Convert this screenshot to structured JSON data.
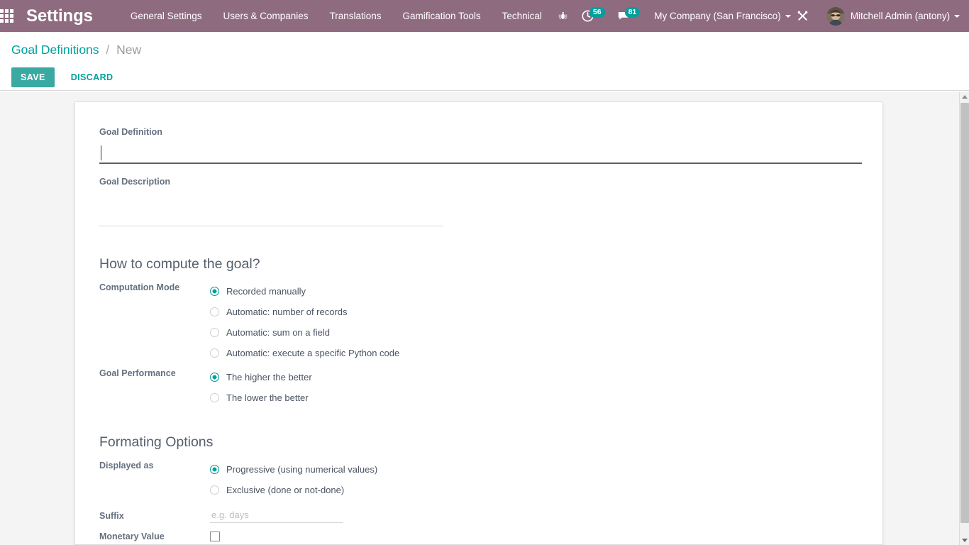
{
  "navbar": {
    "apps_icon": "apps-grid-icon",
    "brand": "Settings",
    "menu": [
      {
        "label": "General Settings"
      },
      {
        "label": "Users & Companies"
      },
      {
        "label": "Translations"
      },
      {
        "label": "Gamification Tools"
      },
      {
        "label": "Technical"
      }
    ],
    "bug_icon": "bug-icon",
    "activities": {
      "icon": "clock-icon",
      "count": "56"
    },
    "messages": {
      "icon": "chat-bubble-icon",
      "count": "81"
    },
    "company": {
      "label": "My Company (San Francisco)",
      "caret": "chevron-down-icon"
    },
    "tools_icon": "tools-icon",
    "user": {
      "name": "Mitchell Admin (antony)",
      "caret": "chevron-down-icon",
      "avatar": "user-avatar"
    },
    "background_color": "#8f6b80"
  },
  "control_panel": {
    "breadcrumb": {
      "root": "Goal Definitions",
      "separator": "/",
      "current": "New"
    },
    "save_label": "SAVE",
    "discard_label": "DISCARD",
    "accent_color": "#00a09d",
    "save_button_color": "#3aa9a2"
  },
  "form": {
    "goal_definition": {
      "label": "Goal Definition",
      "value": "",
      "placeholder": ""
    },
    "goal_description": {
      "label": "Goal Description",
      "value": "",
      "placeholder": ""
    },
    "compute_section": {
      "title": "How to compute the goal?",
      "computation_mode": {
        "label": "Computation Mode",
        "options": [
          {
            "label": "Recorded manually",
            "selected": true
          },
          {
            "label": "Automatic: number of records",
            "selected": false
          },
          {
            "label": "Automatic: sum on a field",
            "selected": false
          },
          {
            "label": "Automatic: execute a specific Python code",
            "selected": false
          }
        ]
      },
      "goal_performance": {
        "label": "Goal Performance",
        "options": [
          {
            "label": "The higher the better",
            "selected": true
          },
          {
            "label": "The lower the better",
            "selected": false
          }
        ]
      }
    },
    "formating_section": {
      "title": "Formating Options",
      "displayed_as": {
        "label": "Displayed as",
        "options": [
          {
            "label": "Progressive (using numerical values)",
            "selected": true
          },
          {
            "label": "Exclusive (done or not-done)",
            "selected": false
          }
        ]
      },
      "suffix": {
        "label": "Suffix",
        "value": "",
        "placeholder": "e.g. days"
      },
      "monetary_value": {
        "label": "Monetary Value",
        "checked": false
      }
    }
  },
  "scrollbar": {
    "up_icon": "triangle-up-icon",
    "down_icon": "triangle-down-icon"
  }
}
